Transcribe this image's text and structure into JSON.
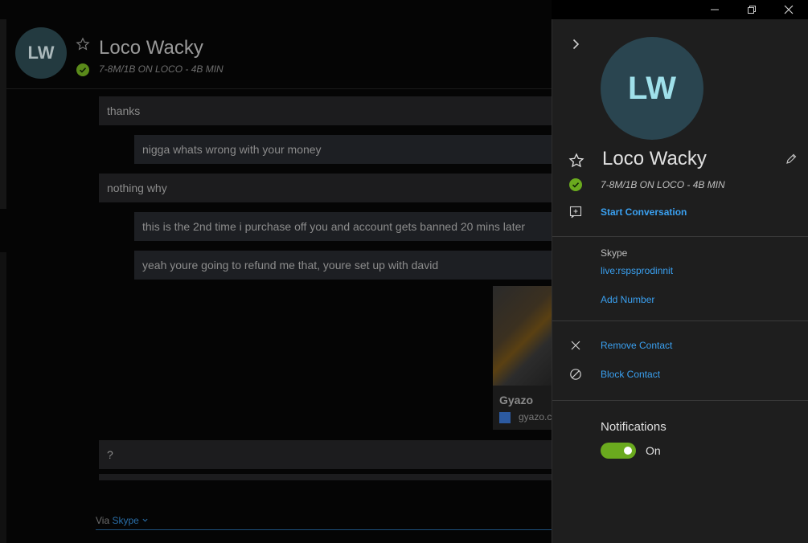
{
  "window": {
    "controls": [
      "minimize-icon",
      "restore-icon",
      "close-icon"
    ]
  },
  "chat": {
    "contact": {
      "initials": "LW",
      "name": "Loco Wacky",
      "status": "7-8M/1B ON LOCO - 4B MIN"
    },
    "messages": [
      {
        "text": "thanks",
        "direction": "in"
      },
      {
        "text": "nigga whats wrong with your money",
        "direction": "out"
      },
      {
        "text": "nothing why",
        "direction": "in"
      },
      {
        "text": "this is the 2nd time i purchase off you and account gets banned 20 mins later",
        "direction": "out"
      },
      {
        "text": "yeah youre going to refund me that, youre set up with david",
        "direction": "out"
      },
      {
        "text": "?",
        "direction": "in"
      }
    ],
    "link_preview": {
      "title": "Gyazo",
      "domain": "gyazo.c"
    },
    "via": {
      "label": "Via",
      "service": "Skype"
    }
  },
  "panel": {
    "initials": "LW",
    "name": "Loco Wacky",
    "status": "7-8M/1B ON LOCO - 4B MIN",
    "start_conversation": "Start Conversation",
    "skype_label": "Skype",
    "skype_id": "live:rspsprodinnit",
    "add_number": "Add Number",
    "remove_contact": "Remove Contact",
    "block_contact": "Block Contact",
    "notifications_label": "Notifications",
    "notifications_state": "On",
    "notifications_on": true
  },
  "colors": {
    "accent": "#3aa0f0",
    "online": "#6aaa1e",
    "panel_bg": "#1e1e1e"
  }
}
